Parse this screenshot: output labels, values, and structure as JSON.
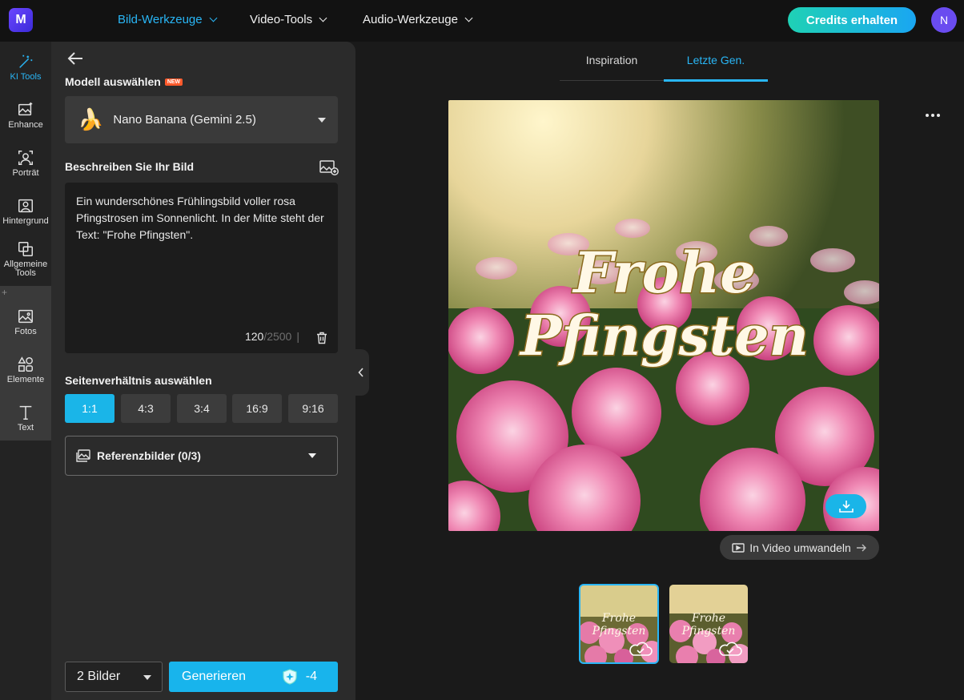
{
  "app": {
    "logo_icon": "media-io-logo-icon"
  },
  "topnav": {
    "items": [
      {
        "label": "Bild-Werkzeuge",
        "active": true
      },
      {
        "label": "Video-Tools",
        "active": false
      },
      {
        "label": "Audio-Werkzeuge",
        "active": false
      }
    ],
    "credits_button": "Credits erhalten",
    "avatar_initial": "N"
  },
  "rail": {
    "items": [
      {
        "label": "KI Tools",
        "icon": "magic-wand-icon",
        "active": true
      },
      {
        "label": "Enhance",
        "icon": "image-enhance-icon"
      },
      {
        "label": "Porträt",
        "icon": "portrait-icon"
      },
      {
        "label": "Hintergrund",
        "icon": "background-icon"
      },
      {
        "label": "Allgemeine Tools",
        "icon": "layers-icon"
      },
      {
        "label": "Fotos",
        "icon": "photo-icon"
      },
      {
        "label": "Elemente",
        "icon": "shapes-icon"
      },
      {
        "label": "Text",
        "icon": "text-icon"
      }
    ],
    "plus": "+"
  },
  "panel": {
    "model_label": "Modell auswählen",
    "new_badge": "NEW",
    "model_value": "Nano Banana (Gemini 2.5)",
    "model_emoji": "🍌",
    "describe_label": "Beschreiben Sie Ihr Bild",
    "prompt_text": "Ein wunderschönes Frühlingsbild voller rosa Pfingstrosen im Sonnenlicht. In der Mitte steht der Text: \"Frohe Pfingsten\".",
    "char_count": "120",
    "char_max": "/2500",
    "char_sep": "|",
    "ratio_label": "Seitenverhältnis auswählen",
    "ratios": [
      {
        "label": "1:1",
        "active": true
      },
      {
        "label": "4:3",
        "active": false
      },
      {
        "label": "3:4",
        "active": false
      },
      {
        "label": "16:9",
        "active": false
      },
      {
        "label": "9:16",
        "active": false
      }
    ],
    "reference_label": "Referenzbilder (0/3)",
    "image_count": "2 Bilder",
    "generate_label": "Generieren",
    "generate_cost": "-4"
  },
  "preview": {
    "tabs": [
      {
        "label": "Inspiration",
        "active": false
      },
      {
        "label": "Letzte Gen.",
        "active": true
      }
    ],
    "image_text_line1": "Frohe",
    "image_text_line2": "Pfingsten",
    "video_button": "In Video umwandeln",
    "thumbnails": [
      {
        "selected": true
      },
      {
        "selected": false
      }
    ]
  },
  "colors": {
    "accent": "#29b6f6",
    "generate": "#18b4ec",
    "credits_start": "#1fd1b5",
    "credits_end": "#1aa6f2",
    "avatar": "#6a4cf0"
  }
}
